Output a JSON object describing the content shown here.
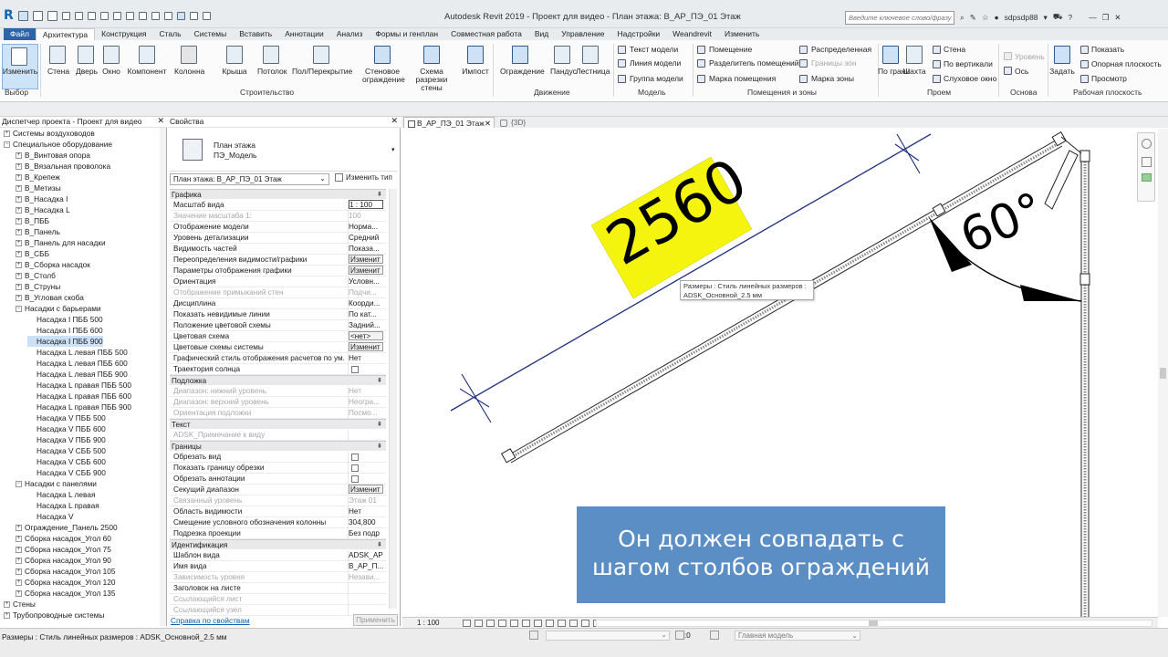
{
  "app": {
    "title": "Autodesk Revit 2019 - Проект для видео - План этажа: В_АР_ПЭ_01 Этаж",
    "search_placeholder": "Введите ключевое слово/фразу",
    "user": "sdpsdp88",
    "logo": "R"
  },
  "tabs": [
    "Файл",
    "Архитектура",
    "Конструкция",
    "Сталь",
    "Системы",
    "Вставить",
    "Аннотации",
    "Анализ",
    "Формы и генплан",
    "Совместная работа",
    "Вид",
    "Управление",
    "Надстройки",
    "Weandrevit",
    "Изменить"
  ],
  "ribbon": {
    "modify": "Изменить",
    "select": "Выбор",
    "build": [
      "Стена",
      "Дверь",
      "Окно",
      "Компонент",
      "Колонна",
      "Крыша",
      "Потолок",
      "Пол/Перекрытие",
      "Стеновое ограждение",
      "Схема разрезки стены",
      "Импост"
    ],
    "build_group": "Строительство",
    "circ": [
      "Ограждение",
      "Пандус",
      "Лестница"
    ],
    "circ_group": "Движение",
    "model": [
      "Текст модели",
      "Линия модели",
      "Группа модели"
    ],
    "model_group": "Модель",
    "room": [
      "Помещение",
      "Разделитель помещений",
      "Марка помещения"
    ],
    "area": [
      "Распределенная",
      "Границы зон",
      "Марка зоны"
    ],
    "room_group": "Помещения и зоны",
    "opening": [
      "По грани",
      "Шахта",
      "Стена",
      "По вертикали",
      "Слуховое окно"
    ],
    "opening_group": "Проем",
    "datum": [
      "Уровень",
      "Ось"
    ],
    "datum_group": "Основа",
    "wp": [
      "Задать",
      "Показать",
      "Опорная плоскость",
      "Просмотр"
    ],
    "wp_group": "Рабочая плоскость"
  },
  "browser": {
    "title": "Диспетчер проекта - Проект для видео",
    "items": [
      "Системы воздуховодов",
      "Специальное оборудование",
      "В_Винтовая опора",
      "В_Вязальная проволока",
      "В_Крепеж",
      "В_Метизы",
      "В_Насадка I",
      "В_Насадка L",
      "В_ПББ",
      "В_Панель",
      "В_Панель для насадки",
      "В_СББ",
      "В_Сборка насадок",
      "В_Столб",
      "В_Струны",
      "В_Угловая скоба",
      "Насадки с барьерами",
      "Насадка I ПББ 500",
      "Насадка I ПББ 600",
      "Насадка I ПББ 900",
      "Насадка L левая ПББ 500",
      "Насадка L левая ПББ 600",
      "Насадка L левая ПББ 900",
      "Насадка L правая ПББ 500",
      "Насадка L правая ПББ 600",
      "Насадка L правая ПББ 900",
      "Насадка V ПББ 500",
      "Насадка V ПББ 600",
      "Насадка V ПББ 900",
      "Насадка V СББ 500",
      "Насадка V СББ 600",
      "Насадка V СББ 900",
      "Насадки с панелями",
      "Насадка L левая",
      "Насадка L правая",
      "Насадка V",
      "Ограждение_Панель 2500",
      "Сборка насадок_Угол 60",
      "Сборка насадок_Угол 75",
      "Сборка насадок_Угол 90",
      "Сборка насадок_Угол 105",
      "Сборка насадок_Угол 120",
      "Сборка насадок_Угол 135",
      "Стены",
      "Трубопроводные системы"
    ]
  },
  "properties": {
    "title": "Свойства",
    "type_name": "План этажа",
    "type_sub": "ПЭ_Модель",
    "view_combo": "План этажа: В_АР_ПЭ_01 Этаж",
    "edit_type": "Изменить тип",
    "sections": {
      "graphics": "Графика",
      "underlay": "Подложка",
      "text": "Текст",
      "extents": "Границы",
      "identity": "Идентификация"
    },
    "rows": [
      {
        "n": "Масштаб вида",
        "v": "1 : 100"
      },
      {
        "n": "Значение масштаба    1:",
        "v": "100"
      },
      {
        "n": "Отображение модели",
        "v": "Норма..."
      },
      {
        "n": "Уровень детализации",
        "v": "Средний"
      },
      {
        "n": "Видимость частей",
        "v": "Показа..."
      },
      {
        "n": "Переопределения видимости/графики",
        "v": "Изменит"
      },
      {
        "n": "Параметры отображения графики",
        "v": "Изменит"
      },
      {
        "n": "Ориентация",
        "v": "Условн..."
      },
      {
        "n": "Отображение примыканий стен",
        "v": "Подчи..."
      },
      {
        "n": "Дисциплина",
        "v": "Коорди..."
      },
      {
        "n": "Показать невидимые линии",
        "v": "По кат..."
      },
      {
        "n": "Положение цветовой схемы",
        "v": "Задний..."
      },
      {
        "n": "Цветовая схема",
        "v": "<нет>"
      },
      {
        "n": "Цветовые схемы системы",
        "v": "Изменит"
      },
      {
        "n": "Графический стиль отображения расчетов по ум...",
        "v": "Нет"
      },
      {
        "n": "Траектория солнца",
        "v": ""
      },
      {
        "n": "Диапазон: нижний уровень",
        "v": "Нет"
      },
      {
        "n": "Диапазон: верхний уровень",
        "v": "Неогра..."
      },
      {
        "n": "Ориентация подложки",
        "v": "Посмо..."
      },
      {
        "n": "ADSK_Примечание к виду",
        "v": ""
      },
      {
        "n": "Обрезать вид",
        "v": ""
      },
      {
        "n": "Показать границу обрезки",
        "v": ""
      },
      {
        "n": "Обрезать аннотации",
        "v": ""
      },
      {
        "n": "Секущий диапазон",
        "v": "Изменит"
      },
      {
        "n": "Связанный уровень",
        "v": "Этаж 01"
      },
      {
        "n": "Область видимости",
        "v": "Нет"
      },
      {
        "n": "Смещение условного обозначения колонны",
        "v": "304,800"
      },
      {
        "n": "Подрезка проекции",
        "v": "Без подр"
      },
      {
        "n": "Шаблон вида",
        "v": "ADSK_АР"
      },
      {
        "n": "Имя вида",
        "v": "В_АР_П..."
      },
      {
        "n": "Зависимость уровня",
        "v": "Незави..."
      },
      {
        "n": "Заголовок на листе",
        "v": ""
      },
      {
        "n": "Ссылающийся лист",
        "v": ""
      },
      {
        "n": "Ссылающийся узел",
        "v": ""
      }
    ],
    "help": "Справка по свойствам",
    "apply": "Применить"
  },
  "viewtabs": [
    "В_АР_ПЭ_01 Этаж",
    "{3D}"
  ],
  "canvas": {
    "dimension": "2560",
    "angle": "60°",
    "tooltip_l1": "Размеры : Стиль линейных размеров :",
    "tooltip_l2": "ADSK_Основной_2.5 мм",
    "caption_l1": "Он должен совпадать с",
    "caption_l2": "шагом столбов ограждений"
  },
  "viewbar": {
    "scale": "1 : 100"
  },
  "status": {
    "text": "Размеры : Стиль линейных размеров : ADSK_Основной_2.5 мм",
    "zero": ":0",
    "model": "Главная модель"
  }
}
